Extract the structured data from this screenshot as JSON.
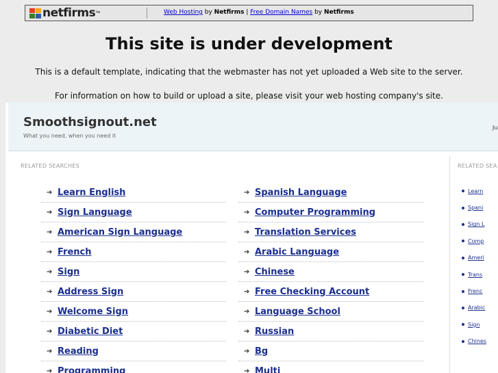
{
  "banner": {
    "logo_text": "netfirms",
    "logo_tm": "™",
    "link1": "Web Hosting",
    "by1": " by ",
    "brand1": "Netfirms",
    "separator": " | ",
    "link2": "Free Domain Names",
    "by2": " by ",
    "brand2": "Netfirms"
  },
  "headline": "This site is under development",
  "info1": "This is a default template, indicating that the webmaster has not yet uploaded a Web site to the server.",
  "info2": "For information on how to build or upload a site, please visit your web hosting company's site.",
  "site": {
    "title": "Smoothsignout.net",
    "tagline": "What you need, when you need it",
    "right_text": "Ju"
  },
  "main": {
    "label": "RELATED SEARCHES",
    "left_links": [
      "Learn English",
      "Sign Language",
      "American Sign Language",
      "French",
      "Sign",
      "Address Sign",
      "Welcome Sign",
      "Diabetic Diet",
      "Reading",
      "Programming"
    ],
    "right_links": [
      "Spanish Language",
      "Computer Programming",
      "Translation Services",
      "Arabic Language",
      "Chinese",
      "Free Checking Account",
      "Language School",
      "Russian",
      "Bg",
      "Multi"
    ],
    "arrow": "➔"
  },
  "sidebar": {
    "label": "RELATED SEA",
    "links": [
      "Learn",
      "Spani",
      "Sign L",
      "Comp",
      "Ameri",
      "Trans",
      "Frenc",
      "Arabic",
      "Sign",
      "Chines"
    ]
  }
}
